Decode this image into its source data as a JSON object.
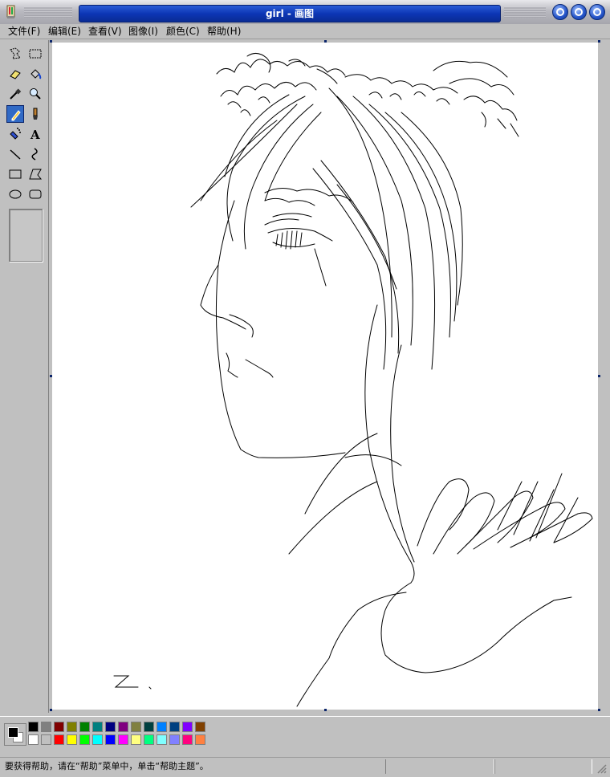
{
  "window": {
    "title": "girl - 画图"
  },
  "menu": [
    {
      "label": "文件(F)"
    },
    {
      "label": "编辑(E)"
    },
    {
      "label": "查看(V)"
    },
    {
      "label": "图像(I)"
    },
    {
      "label": "颜色(C)"
    },
    {
      "label": "帮助(H)"
    }
  ],
  "tools": [
    {
      "name": "free-form-select-tool"
    },
    {
      "name": "rectangle-select-tool"
    },
    {
      "name": "eraser-tool"
    },
    {
      "name": "fill-bucket-tool"
    },
    {
      "name": "color-picker-tool"
    },
    {
      "name": "magnifier-tool"
    },
    {
      "name": "pencil-tool",
      "selected": true
    },
    {
      "name": "brush-tool"
    },
    {
      "name": "airbrush-tool"
    },
    {
      "name": "text-tool",
      "glyph": "A"
    },
    {
      "name": "line-tool"
    },
    {
      "name": "curve-tool"
    },
    {
      "name": "rectangle-tool"
    },
    {
      "name": "polygon-tool"
    },
    {
      "name": "ellipse-tool"
    },
    {
      "name": "rounded-rectangle-tool"
    }
  ],
  "colors": {
    "foreground": "#000000",
    "background": "#ffffff",
    "palette_top": [
      "#000000",
      "#808080",
      "#800000",
      "#808000",
      "#008000",
      "#008080",
      "#000080",
      "#800080",
      "#808040",
      "#004040",
      "#0080ff",
      "#004080",
      "#8000ff",
      "#804000"
    ],
    "palette_bottom": [
      "#ffffff",
      "#c0c0c0",
      "#ff0000",
      "#ffff00",
      "#00ff00",
      "#00ffff",
      "#0000ff",
      "#ff00ff",
      "#ffff80",
      "#00ff80",
      "#80ffff",
      "#8080ff",
      "#ff0080",
      "#ff8040"
    ]
  },
  "status": {
    "help_text": "要获得帮助，请在“帮助”菜单中，单击“帮助主题”。"
  }
}
